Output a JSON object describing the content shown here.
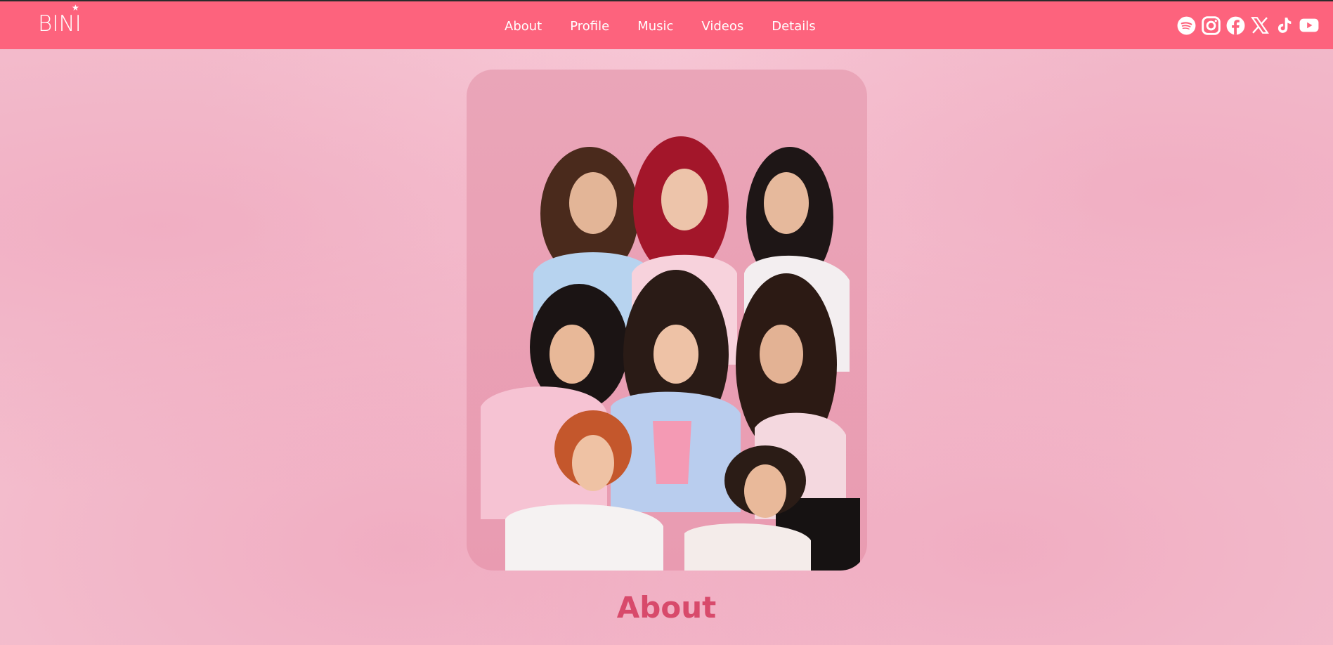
{
  "brand": {
    "logo_text": "BINI",
    "logo_star": "★",
    "nav_color": "#fd637d",
    "accent_color": "#d84a6b",
    "background_color": "#f4c0cf"
  },
  "nav": {
    "links": [
      {
        "label": "About"
      },
      {
        "label": "Profile"
      },
      {
        "label": "Music"
      },
      {
        "label": "Videos"
      },
      {
        "label": "Details"
      }
    ]
  },
  "social": {
    "icons": [
      "spotify-icon",
      "instagram-icon",
      "facebook-icon",
      "x-icon",
      "tiktok-icon",
      "youtube-icon"
    ]
  },
  "hero": {
    "image_name": "group-photo"
  },
  "section": {
    "title": "About"
  }
}
